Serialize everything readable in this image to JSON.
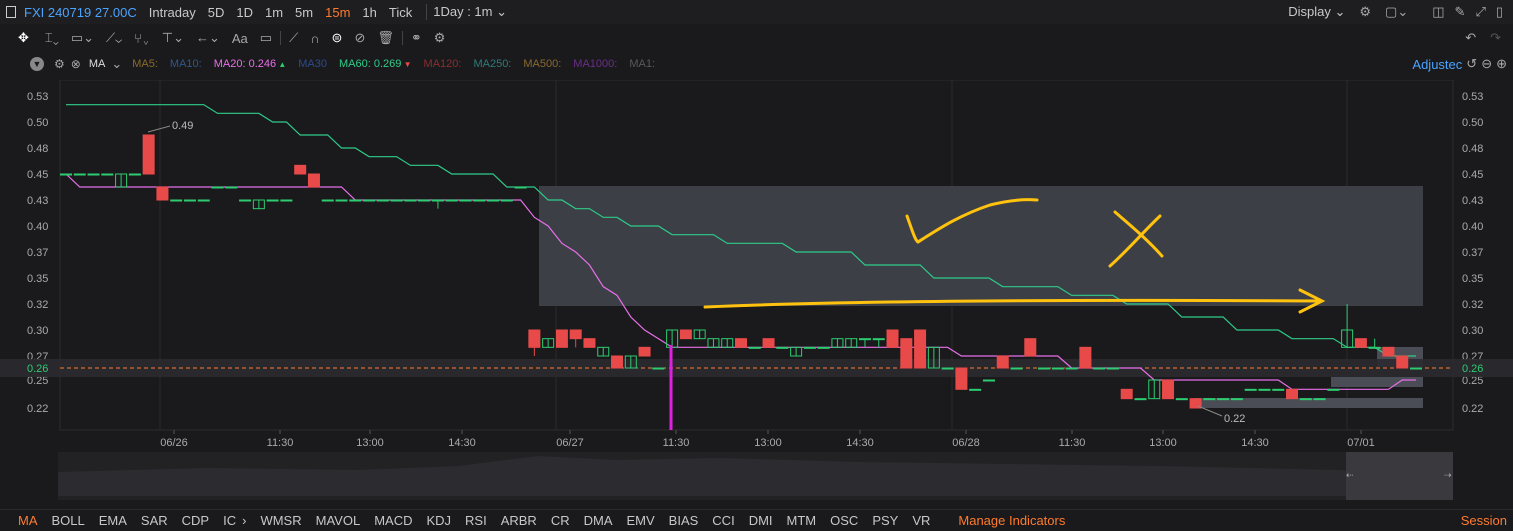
{
  "topbar": {
    "symbol": "FXI 240719 27.00C",
    "timeframes": [
      "Intraday",
      "5D",
      "1D",
      "1m",
      "5m",
      "15m",
      "1h",
      "Tick"
    ],
    "active_timeframe": "15m",
    "period_select": "1Day : 1m",
    "display_label": "Display"
  },
  "indicator_bar": {
    "type": "MA",
    "items": [
      {
        "label": "MA5:",
        "value": "",
        "color": "#8a6a2e"
      },
      {
        "label": "MA10:",
        "value": "",
        "color": "#2e5a8a"
      },
      {
        "label": "MA20:",
        "value": "0.246",
        "color": "#e86fe8",
        "arrow": "▲"
      },
      {
        "label": "MA30",
        "value": "",
        "color": "#2e4a8a"
      },
      {
        "label": "MA60:",
        "value": "0.269",
        "color": "#2ecc8a",
        "arrow": "▼"
      },
      {
        "label": "MA120:",
        "value": "",
        "color": "#8a2e2e"
      },
      {
        "label": "MA250:",
        "value": "",
        "color": "#2e7a7a"
      },
      {
        "label": "MA500:",
        "value": "",
        "color": "#8a6a2e"
      },
      {
        "label": "MA1000:",
        "value": "",
        "color": "#6a2e8a"
      },
      {
        "label": "MA1:",
        "value": "",
        "color": "#5a5a5a"
      }
    ],
    "adjusted_label": "Adjustec"
  },
  "chart_data": {
    "type": "candlestick",
    "y_ticks": [
      "0.53",
      "0.50",
      "0.48",
      "0.45",
      "0.43",
      "0.40",
      "0.37",
      "0.35",
      "0.32",
      "0.30",
      "0.27",
      "0.25",
      "0.22"
    ],
    "current_price": "0.26",
    "x_ticks": [
      "06/26",
      "11:30",
      "13:00",
      "14:30",
      "06/27",
      "11:30",
      "13:00",
      "14:30",
      "06/28",
      "11:30",
      "13:00",
      "14:30",
      "07/01"
    ],
    "high_label": "0.49",
    "low_label": "0.22",
    "candles": [
      {
        "o": 0.45,
        "h": 0.45,
        "l": 0.45,
        "c": 0.45
      },
      {
        "o": 0.45,
        "h": 0.45,
        "l": 0.45,
        "c": 0.45
      },
      {
        "o": 0.45,
        "h": 0.45,
        "l": 0.45,
        "c": 0.45
      },
      {
        "o": 0.45,
        "h": 0.45,
        "l": 0.45,
        "c": 0.45
      },
      {
        "o": 0.44,
        "h": 0.45,
        "l": 0.44,
        "c": 0.45
      },
      {
        "o": 0.45,
        "h": 0.45,
        "l": 0.45,
        "c": 0.45
      },
      {
        "o": 0.49,
        "h": 0.49,
        "l": 0.45,
        "c": 0.45
      },
      {
        "o": 0.44,
        "h": 0.44,
        "l": 0.43,
        "c": 0.43
      },
      {
        "o": 0.43,
        "h": 0.43,
        "l": 0.43,
        "c": 0.43
      },
      {
        "o": 0.43,
        "h": 0.43,
        "l": 0.43,
        "c": 0.43
      },
      {
        "o": 0.43,
        "h": 0.43,
        "l": 0.43,
        "c": 0.43
      },
      {
        "o": 0.44,
        "h": 0.44,
        "l": 0.44,
        "c": 0.44
      },
      {
        "o": 0.44,
        "h": 0.44,
        "l": 0.44,
        "c": 0.44
      },
      {
        "o": 0.43,
        "h": 0.43,
        "l": 0.43,
        "c": 0.43
      },
      {
        "o": 0.42,
        "h": 0.43,
        "l": 0.42,
        "c": 0.43
      },
      {
        "o": 0.43,
        "h": 0.43,
        "l": 0.43,
        "c": 0.43
      },
      {
        "o": 0.43,
        "h": 0.43,
        "l": 0.43,
        "c": 0.43
      },
      {
        "o": 0.46,
        "h": 0.46,
        "l": 0.45,
        "c": 0.45
      },
      {
        "o": 0.45,
        "h": 0.45,
        "l": 0.44,
        "c": 0.44
      },
      {
        "o": 0.43,
        "h": 0.43,
        "l": 0.43,
        "c": 0.43
      },
      {
        "o": 0.43,
        "h": 0.43,
        "l": 0.43,
        "c": 0.43
      },
      {
        "o": 0.43,
        "h": 0.43,
        "l": 0.43,
        "c": 0.43
      },
      {
        "o": 0.43,
        "h": 0.43,
        "l": 0.43,
        "c": 0.43
      },
      {
        "o": 0.43,
        "h": 0.43,
        "l": 0.43,
        "c": 0.43
      },
      {
        "o": 0.43,
        "h": 0.43,
        "l": 0.43,
        "c": 0.43
      },
      {
        "o": 0.43,
        "h": 0.43,
        "l": 0.43,
        "c": 0.43
      },
      {
        "o": 0.43,
        "h": 0.43,
        "l": 0.43,
        "c": 0.43
      },
      {
        "o": 0.43,
        "h": 0.43,
        "l": 0.42,
        "c": 0.43
      },
      {
        "o": 0.43,
        "h": 0.43,
        "l": 0.43,
        "c": 0.43
      },
      {
        "o": 0.43,
        "h": 0.43,
        "l": 0.43,
        "c": 0.43
      },
      {
        "o": 0.43,
        "h": 0.43,
        "l": 0.43,
        "c": 0.43
      },
      {
        "o": 0.43,
        "h": 0.43,
        "l": 0.43,
        "c": 0.43
      },
      {
        "o": 0.43,
        "h": 0.43,
        "l": 0.43,
        "c": 0.43
      },
      {
        "o": 0.44,
        "h": 0.44,
        "l": 0.44,
        "c": 0.44
      },
      {
        "o": 0.3,
        "h": 0.3,
        "l": 0.27,
        "c": 0.28
      },
      {
        "o": 0.28,
        "h": 0.29,
        "l": 0.28,
        "c": 0.29
      },
      {
        "o": 0.3,
        "h": 0.3,
        "l": 0.28,
        "c": 0.28
      },
      {
        "o": 0.3,
        "h": 0.3,
        "l": 0.28,
        "c": 0.29
      },
      {
        "o": 0.29,
        "h": 0.29,
        "l": 0.28,
        "c": 0.28
      },
      {
        "o": 0.27,
        "h": 0.28,
        "l": 0.27,
        "c": 0.28
      },
      {
        "o": 0.27,
        "h": 0.27,
        "l": 0.26,
        "c": 0.26
      },
      {
        "o": 0.26,
        "h": 0.27,
        "l": 0.26,
        "c": 0.27
      },
      {
        "o": 0.28,
        "h": 0.28,
        "l": 0.27,
        "c": 0.27
      },
      {
        "o": 0.26,
        "h": 0.26,
        "l": 0.26,
        "c": 0.26
      },
      {
        "o": 0.28,
        "h": 0.3,
        "l": 0.28,
        "c": 0.3
      },
      {
        "o": 0.3,
        "h": 0.3,
        "l": 0.29,
        "c": 0.29
      },
      {
        "o": 0.29,
        "h": 0.3,
        "l": 0.29,
        "c": 0.3
      },
      {
        "o": 0.28,
        "h": 0.29,
        "l": 0.28,
        "c": 0.29
      },
      {
        "o": 0.28,
        "h": 0.29,
        "l": 0.28,
        "c": 0.29
      },
      {
        "o": 0.29,
        "h": 0.29,
        "l": 0.28,
        "c": 0.28
      },
      {
        "o": 0.28,
        "h": 0.28,
        "l": 0.28,
        "c": 0.28
      },
      {
        "o": 0.29,
        "h": 0.29,
        "l": 0.28,
        "c": 0.28
      },
      {
        "o": 0.28,
        "h": 0.28,
        "l": 0.28,
        "c": 0.28
      },
      {
        "o": 0.27,
        "h": 0.28,
        "l": 0.27,
        "c": 0.28
      },
      {
        "o": 0.28,
        "h": 0.28,
        "l": 0.28,
        "c": 0.28
      },
      {
        "o": 0.28,
        "h": 0.28,
        "l": 0.28,
        "c": 0.28
      },
      {
        "o": 0.28,
        "h": 0.29,
        "l": 0.28,
        "c": 0.29
      },
      {
        "o": 0.28,
        "h": 0.29,
        "l": 0.28,
        "c": 0.29
      },
      {
        "o": 0.29,
        "h": 0.29,
        "l": 0.28,
        "c": 0.29
      },
      {
        "o": 0.29,
        "h": 0.29,
        "l": 0.28,
        "c": 0.29
      },
      {
        "o": 0.3,
        "h": 0.3,
        "l": 0.28,
        "c": 0.28
      },
      {
        "o": 0.29,
        "h": 0.29,
        "l": 0.26,
        "c": 0.26
      },
      {
        "o": 0.3,
        "h": 0.3,
        "l": 0.26,
        "c": 0.26
      },
      {
        "o": 0.26,
        "h": 0.28,
        "l": 0.26,
        "c": 0.28
      },
      {
        "o": 0.26,
        "h": 0.26,
        "l": 0.26,
        "c": 0.26
      },
      {
        "o": 0.26,
        "h": 0.26,
        "l": 0.24,
        "c": 0.24
      },
      {
        "o": 0.24,
        "h": 0.24,
        "l": 0.24,
        "c": 0.24
      },
      {
        "o": 0.25,
        "h": 0.25,
        "l": 0.25,
        "c": 0.25
      },
      {
        "o": 0.27,
        "h": 0.27,
        "l": 0.26,
        "c": 0.26
      },
      {
        "o": 0.26,
        "h": 0.26,
        "l": 0.26,
        "c": 0.26
      },
      {
        "o": 0.29,
        "h": 0.29,
        "l": 0.27,
        "c": 0.27
      },
      {
        "o": 0.26,
        "h": 0.26,
        "l": 0.26,
        "c": 0.26
      },
      {
        "o": 0.26,
        "h": 0.26,
        "l": 0.26,
        "c": 0.26
      },
      {
        "o": 0.26,
        "h": 0.26,
        "l": 0.26,
        "c": 0.26
      },
      {
        "o": 0.28,
        "h": 0.28,
        "l": 0.26,
        "c": 0.26
      },
      {
        "o": 0.26,
        "h": 0.26,
        "l": 0.26,
        "c": 0.26
      },
      {
        "o": 0.26,
        "h": 0.26,
        "l": 0.26,
        "c": 0.26
      },
      {
        "o": 0.24,
        "h": 0.24,
        "l": 0.23,
        "c": 0.23
      },
      {
        "o": 0.23,
        "h": 0.23,
        "l": 0.23,
        "c": 0.23
      },
      {
        "o": 0.23,
        "h": 0.25,
        "l": 0.23,
        "c": 0.25
      },
      {
        "o": 0.25,
        "h": 0.25,
        "l": 0.23,
        "c": 0.23
      },
      {
        "o": 0.23,
        "h": 0.23,
        "l": 0.23,
        "c": 0.23
      },
      {
        "o": 0.23,
        "h": 0.23,
        "l": 0.22,
        "c": 0.22
      },
      {
        "o": 0.23,
        "h": 0.23,
        "l": 0.23,
        "c": 0.23
      },
      {
        "o": 0.23,
        "h": 0.23,
        "l": 0.23,
        "c": 0.23
      },
      {
        "o": 0.23,
        "h": 0.23,
        "l": 0.23,
        "c": 0.23
      },
      {
        "o": 0.24,
        "h": 0.24,
        "l": 0.24,
        "c": 0.24
      },
      {
        "o": 0.24,
        "h": 0.24,
        "l": 0.24,
        "c": 0.24
      },
      {
        "o": 0.24,
        "h": 0.24,
        "l": 0.24,
        "c": 0.24
      },
      {
        "o": 0.24,
        "h": 0.24,
        "l": 0.23,
        "c": 0.23
      },
      {
        "o": 0.23,
        "h": 0.23,
        "l": 0.23,
        "c": 0.23
      },
      {
        "o": 0.23,
        "h": 0.23,
        "l": 0.23,
        "c": 0.23
      },
      {
        "o": 0.24,
        "h": 0.24,
        "l": 0.24,
        "c": 0.24
      },
      {
        "o": 0.28,
        "h": 0.32,
        "l": 0.28,
        "c": 0.3
      },
      {
        "o": 0.29,
        "h": 0.29,
        "l": 0.28,
        "c": 0.28
      },
      {
        "o": 0.28,
        "h": 0.29,
        "l": 0.28,
        "c": 0.28
      },
      {
        "o": 0.28,
        "h": 0.28,
        "l": 0.27,
        "c": 0.27
      },
      {
        "o": 0.27,
        "h": 0.27,
        "l": 0.26,
        "c": 0.26
      },
      {
        "o": 0.26,
        "h": 0.26,
        "l": 0.26,
        "c": 0.26
      }
    ],
    "ma20": [
      0.45,
      0.44,
      0.44,
      0.44,
      0.44,
      0.44,
      0.44,
      0.44,
      0.44,
      0.44,
      0.44,
      0.44,
      0.44,
      0.44,
      0.44,
      0.44,
      0.44,
      0.44,
      0.44,
      0.44,
      0.44,
      0.43,
      0.43,
      0.43,
      0.43,
      0.43,
      0.43,
      0.43,
      0.43,
      0.43,
      0.43,
      0.43,
      0.43,
      0.43,
      0.41,
      0.4,
      0.38,
      0.37,
      0.36,
      0.34,
      0.33,
      0.31,
      0.3,
      0.29,
      0.28,
      0.28,
      0.28,
      0.28,
      0.28,
      0.28,
      0.28,
      0.28,
      0.28,
      0.28,
      0.28,
      0.28,
      0.28,
      0.28,
      0.28,
      0.28,
      0.28,
      0.28,
      0.28,
      0.28,
      0.28,
      0.27,
      0.27,
      0.27,
      0.27,
      0.27,
      0.27,
      0.27,
      0.27,
      0.26,
      0.26,
      0.26,
      0.26,
      0.26,
      0.26,
      0.25,
      0.25,
      0.25,
      0.25,
      0.25,
      0.25,
      0.25,
      0.25,
      0.25,
      0.25,
      0.24,
      0.24,
      0.24,
      0.24,
      0.24,
      0.24,
      0.24,
      0.24,
      0.25,
      0.25,
      0.25
    ],
    "ma60": [
      0.52,
      0.52,
      0.52,
      0.52,
      0.52,
      0.52,
      0.52,
      0.52,
      0.52,
      0.52,
      0.52,
      0.51,
      0.51,
      0.51,
      0.51,
      0.5,
      0.5,
      0.49,
      0.49,
      0.49,
      0.48,
      0.48,
      0.47,
      0.47,
      0.47,
      0.46,
      0.46,
      0.46,
      0.45,
      0.45,
      0.45,
      0.45,
      0.44,
      0.44,
      0.44,
      0.43,
      0.43,
      0.42,
      0.42,
      0.41,
      0.41,
      0.4,
      0.4,
      0.4,
      0.39,
      0.39,
      0.39,
      0.39,
      0.38,
      0.38,
      0.38,
      0.38,
      0.38,
      0.37,
      0.37,
      0.37,
      0.37,
      0.37,
      0.36,
      0.36,
      0.36,
      0.36,
      0.36,
      0.35,
      0.35,
      0.35,
      0.35,
      0.35,
      0.34,
      0.34,
      0.34,
      0.34,
      0.34,
      0.33,
      0.33,
      0.33,
      0.33,
      0.32,
      0.32,
      0.32,
      0.32,
      0.31,
      0.31,
      0.31,
      0.31,
      0.3,
      0.3,
      0.3,
      0.3,
      0.29,
      0.29,
      0.29,
      0.29,
      0.28,
      0.28,
      0.28,
      0.27,
      0.27,
      0.27,
      0.27
    ],
    "ylim": [
      0.2,
      0.55
    ]
  },
  "bottombar": {
    "items": [
      "MA",
      "BOLL",
      "EMA",
      "SAR",
      "CDP",
      "IC",
      "WMSR",
      "MAVOL",
      "MACD",
      "KDJ",
      "RSI",
      "ARBR",
      "CR",
      "DMA",
      "EMV",
      "BIAS",
      "CCI",
      "DMI",
      "MTM",
      "OSC",
      "PSY",
      "VR"
    ],
    "active": "MA",
    "manage_label": "Manage Indicators",
    "session_label": "Session"
  },
  "colors": {
    "up": "#e84a4a",
    "down": "#2ecc71",
    "accent": "#ff7b2e",
    "ma20": "#e86fe8",
    "ma60": "#2ecc8a",
    "highlight": "#3e4149",
    "annotation": "#ffc20e"
  }
}
